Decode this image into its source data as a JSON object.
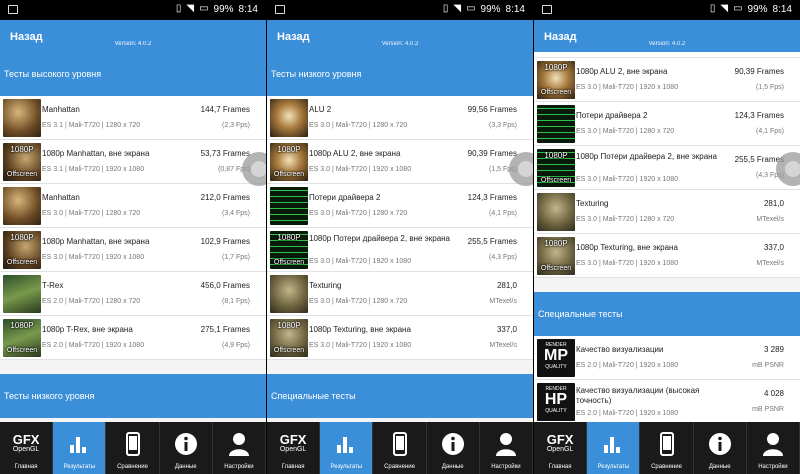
{
  "status": {
    "battery": "99%",
    "time": "8:14"
  },
  "appbar": {
    "back": "Назад",
    "version": "Version: 4.0.2"
  },
  "nav": [
    {
      "label": "Главная",
      "icon": "gfx-opengl-logo",
      "logo_top": "GFX",
      "logo_bottom": "OpenGL"
    },
    {
      "label": "Результаты",
      "icon": "bar-chart-icon"
    },
    {
      "label": "Сравнение",
      "icon": "phone-icon"
    },
    {
      "label": "Данные",
      "icon": "info-icon"
    },
    {
      "label": "Настройки",
      "icon": "user-icon"
    }
  ],
  "panel1": {
    "section_high": "Тесты высокого уровня",
    "section_low": "Тесты низкого уровня",
    "rows": [
      {
        "name": "Manhattan",
        "sub": "ES 3.1 | Mali-T720 | 1280 x 720",
        "val": "144,7 Frames",
        "val2": "(2,3 Fps)",
        "thumb": "t-man",
        "tag": ""
      },
      {
        "name": "1080p Manhattan, вне экрана",
        "sub": "ES 3.1 | Mali-T720 | 1920 x 1080",
        "val": "53,73 Frames",
        "val2": "(0,87 Fps)",
        "thumb": "t-man2",
        "tag": "1080P",
        "tag2": "Offscreen"
      },
      {
        "name": "Manhattan",
        "sub": "ES 3.0 | Mali-T720 | 1280 x 720",
        "val": "212,0 Frames",
        "val2": "(3,4 Fps)",
        "thumb": "t-man",
        "tag": ""
      },
      {
        "name": "1080p Manhattan, вне экрана",
        "sub": "ES 3.0 | Mali-T720 | 1920 x 1080",
        "val": "102,9 Frames",
        "val2": "(1,7 Fps)",
        "thumb": "t-man2",
        "tag": "1080P",
        "tag2": "Offscreen"
      },
      {
        "name": "T-Rex",
        "sub": "ES 2.0 | Mali-T720 | 1280 x 720",
        "val": "456,0 Frames",
        "val2": "(8,1 Fps)",
        "thumb": "t-trex",
        "tag": ""
      },
      {
        "name": "1080p T-Rex, вне экрана",
        "sub": "ES 2.0 | Mali-T720 | 1920 x 1080",
        "val": "275,1 Frames",
        "val2": "(4,9 Fps)",
        "thumb": "t-trex",
        "tag": "1080P",
        "tag2": "Offscreen"
      }
    ]
  },
  "panel2": {
    "section_low": "Тесты низкого уровня",
    "section_special": "Специальные тесты",
    "rows": [
      {
        "name": "ALU 2",
        "sub": "ES 3.0 | Mali-T720 | 1280 x 720",
        "val": "99,56 Frames",
        "val2": "(3,3 Fps)",
        "thumb": "t-alu",
        "tag": ""
      },
      {
        "name": "1080p ALU 2, вне экрана",
        "sub": "ES 3.0 | Mali-T720 | 1920 x 1080",
        "val": "90,39 Frames",
        "val2": "(1,5 Fps)",
        "thumb": "t-alu",
        "tag": "1080P",
        "tag2": "Offscreen"
      },
      {
        "name": "Потери драйвера 2",
        "sub": "ES 3.0 | Mali-T720 | 1280 x 720",
        "val": "124,3 Frames",
        "val2": "(4,1 Fps)",
        "thumb": "t-drv",
        "tag": ""
      },
      {
        "name": "1080p Потери драйвера 2, вне экрана",
        "sub": "ES 3.0 | Mali-T720 | 1920 x 1080",
        "val": "255,5 Frames",
        "val2": "(4,3 Fps)",
        "thumb": "t-drv",
        "tag": "1080P",
        "tag2": "Offscreen",
        "two": true
      },
      {
        "name": "Texturing",
        "sub": "ES 3.0 | Mali-T720 | 1280 x 720",
        "val": "281,0",
        "val2": "MTexel/s",
        "thumb": "t-tex",
        "tag": ""
      },
      {
        "name": "1080p Texturing, вне экрана",
        "sub": "ES 3.0 | Mali-T720 | 1920 x 1080",
        "val": "337,0",
        "val2": "MTexel/s",
        "thumb": "t-tex",
        "tag": "1080P",
        "tag2": "Offscreen"
      }
    ]
  },
  "panel3": {
    "section_special": "Специальные тесты",
    "rows": [
      {
        "name": "1080p ALU 2, вне экрана",
        "sub": "ES 3.0 | Mali-T720 | 1920 x 1080",
        "val": "90,39 Frames",
        "val2": "(1,5 Fps)",
        "thumb": "t-alu",
        "tag": "1080P",
        "tag2": "Offscreen"
      },
      {
        "name": "Потери драйвера 2",
        "sub": "ES 3.0 | Mali-T720 | 1280 x 720",
        "val": "124,3 Frames",
        "val2": "(4,1 Fps)",
        "thumb": "t-drv",
        "tag": ""
      },
      {
        "name": "1080p Потери драйвера 2, вне экрана",
        "sub": "ES 3.0 | Mali-T720 | 1920 x 1080",
        "val": "255,5 Frames",
        "val2": "(4,3 Fps)",
        "thumb": "t-drv",
        "tag": "1080P",
        "tag2": "Offscreen",
        "two": true
      },
      {
        "name": "Texturing",
        "sub": "ES 3.0 | Mali-T720 | 1280 x 720",
        "val": "281,0",
        "val2": "MTexel/s",
        "thumb": "t-tex",
        "tag": ""
      },
      {
        "name": "1080p Texturing, вне экрана",
        "sub": "ES 3.0 | Mali-T720 | 1920 x 1080",
        "val": "337,0",
        "val2": "MTexel/s",
        "thumb": "t-tex",
        "tag": "1080P",
        "tag2": "Offscreen"
      }
    ],
    "special_rows": [
      {
        "name": "Качество визуализации",
        "sub": "ES 2.0 | Mali-T720 | 1920 x 1080",
        "val": "3 289",
        "val2": "mB PSNR",
        "badge_top": "RENDER",
        "badge_mid": "MP",
        "badge_bot": "QUALITY"
      },
      {
        "name": "Качество визуализации (высокая точность)",
        "sub": "ES 2.0 | Mali-T720 | 1920 x 1080",
        "val": "4 028",
        "val2": "mB PSNR",
        "badge_top": "RENDER",
        "badge_mid": "HP",
        "badge_bot": "QUALITY",
        "two": true
      }
    ]
  }
}
